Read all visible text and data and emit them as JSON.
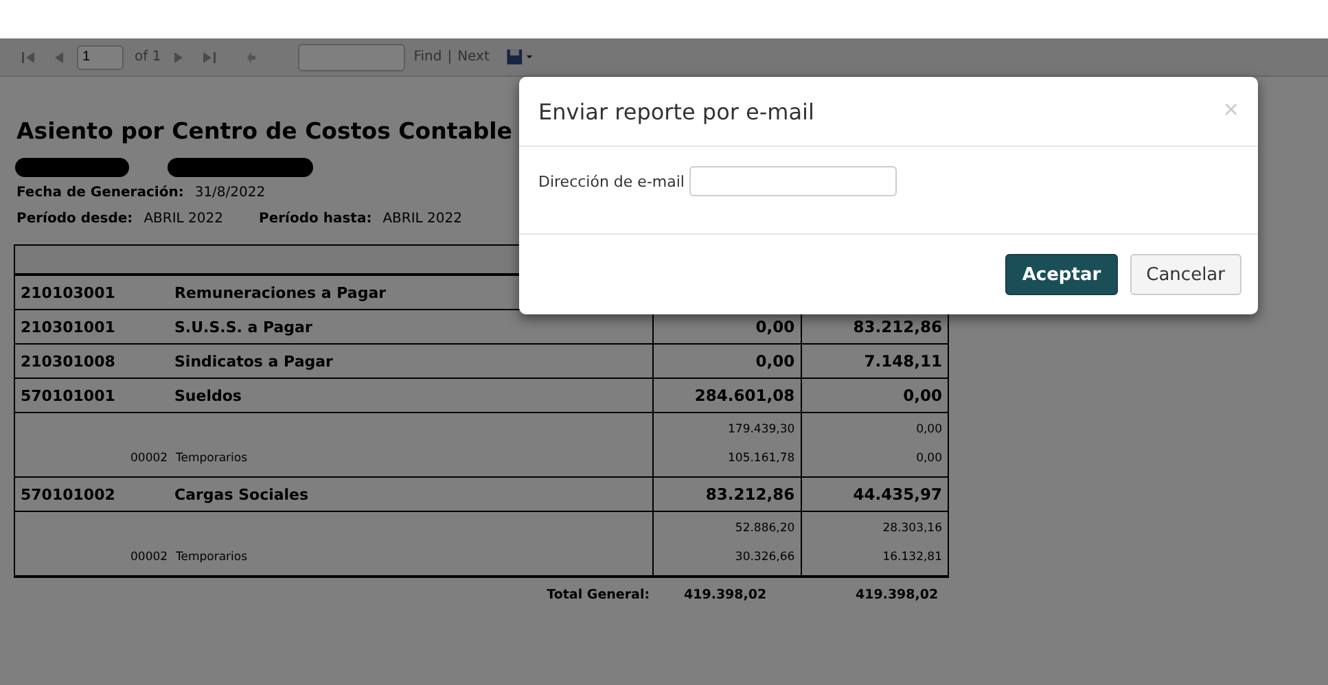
{
  "toolbar": {
    "page": "1",
    "page_count": "of 1",
    "find": "Find",
    "separator": "|",
    "next": "Next"
  },
  "report": {
    "title": "Asiento por Centro de Costos Contable",
    "meta": [
      {
        "label": "Fecha de Generación:",
        "value": "31/8/2022"
      },
      {
        "label": "Período desde:",
        "value": "ABRIL 2022"
      },
      {
        "label": "Período hasta:",
        "value": "ABRIL 2022"
      }
    ],
    "rows": [
      {
        "kind": "account",
        "code": "210103001",
        "name": "Remuneraciones a Pagar"
      },
      {
        "kind": "account",
        "code": "210301001",
        "name": "S.U.S.S. a Pagar",
        "debit": "0,00",
        "credit": "83.212,86"
      },
      {
        "kind": "account",
        "code": "210301008",
        "name": "Sindicatos a Pagar",
        "debit": "0,00",
        "credit": "7.148,11"
      },
      {
        "kind": "account",
        "code": "570101001",
        "name": "Sueldos",
        "debit": "284.601,08",
        "credit": "0,00"
      },
      {
        "kind": "detail",
        "lines": [
          {
            "debit": "179.439,30",
            "credit": "0,00"
          },
          {
            "code": "00002",
            "name": "Temporarios",
            "debit": "105.161,78",
            "credit": "0,00"
          }
        ]
      },
      {
        "kind": "account",
        "code": "570101002",
        "name": "Cargas Sociales",
        "debit": "83.212,86",
        "credit": "44.435,97"
      },
      {
        "kind": "detail",
        "lines": [
          {
            "debit": "52.886,20",
            "credit": "28.303,16"
          },
          {
            "code": "00002",
            "name": "Temporarios",
            "debit": "30.326,66",
            "credit": "16.132,81"
          }
        ]
      }
    ],
    "total": {
      "label": "Total General:",
      "debit": "419.398,02",
      "credit": "419.398,02"
    }
  },
  "dialog": {
    "title": "Enviar reporte por e-mail",
    "close": "×",
    "field_label": "Dirección de e-mail",
    "buttons": [
      {
        "label": "Aceptar",
        "kind": "primary"
      },
      {
        "label": "Cancelar",
        "kind": "secondary"
      }
    ]
  }
}
